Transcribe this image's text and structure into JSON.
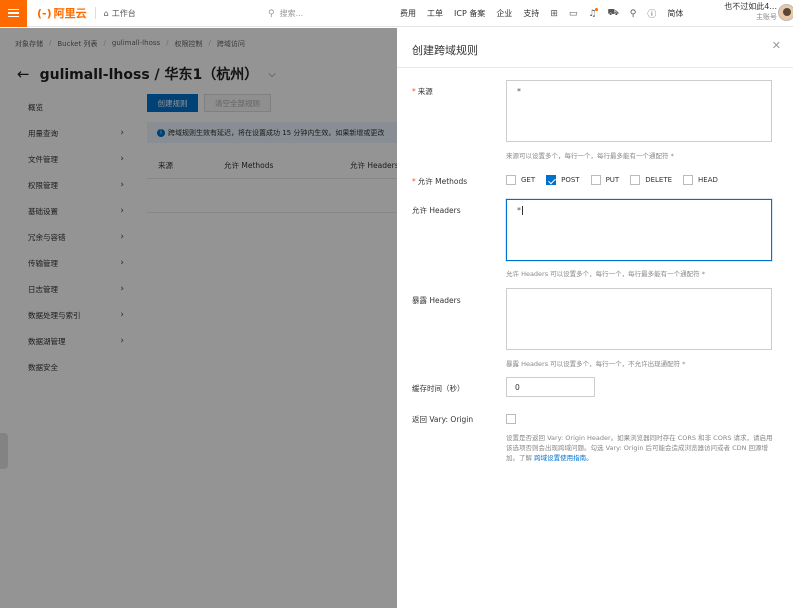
{
  "topbar": {
    "logo_text": "阿里云",
    "logo_mark": "(-)",
    "workbench": "工作台",
    "search_placeholder": "搜索...",
    "nav": [
      "费用",
      "工单",
      "ICP 备案",
      "企业",
      "支持"
    ],
    "lang": "简体",
    "user_name": "也不过如此4...",
    "user_role": "主账号"
  },
  "breadcrumb": [
    "对象存储",
    "Bucket 列表",
    "gulimall-lhoss",
    "权限控制",
    "跨域访问"
  ],
  "bucket": {
    "name": "gulimall-lhoss / 华东1（杭州）"
  },
  "sidenav": [
    {
      "label": "概览",
      "arrow": false
    },
    {
      "label": "用量查询",
      "arrow": true
    },
    {
      "label": "文件管理",
      "arrow": true
    },
    {
      "label": "权限管理",
      "arrow": true
    },
    {
      "label": "基础设置",
      "arrow": true
    },
    {
      "label": "冗余与容错",
      "arrow": true
    },
    {
      "label": "传输管理",
      "arrow": true
    },
    {
      "label": "日志管理",
      "arrow": true
    },
    {
      "label": "数据处理与索引",
      "arrow": true
    },
    {
      "label": "数据湖管理",
      "arrow": true
    },
    {
      "label": "数据安全",
      "arrow": false
    }
  ],
  "content": {
    "create_button": "创建规则",
    "clear_button": "清空全部规则",
    "notice": "跨域规则生效有延迟，将在设置成功 15 分钟内生效。如果新增或更改",
    "columns": [
      "来源",
      "允许 Methods",
      "允许 Headers"
    ]
  },
  "drawer": {
    "title": "创建跨域规则",
    "source_label": "来源",
    "source_value": "*",
    "source_help": "来源可以设置多个，每行一个，每行最多能有一个通配符 *",
    "methods_label": "允许 Methods",
    "methods": [
      {
        "name": "GET",
        "checked": false
      },
      {
        "name": "POST",
        "checked": true
      },
      {
        "name": "PUT",
        "checked": false
      },
      {
        "name": "DELETE",
        "checked": false
      },
      {
        "name": "HEAD",
        "checked": false
      }
    ],
    "headers_label": "允许 Headers",
    "headers_value": "*",
    "headers_help": "允许 Headers 可以设置多个，每行一个，每行最多能有一个通配符 *",
    "expose_label": "暴露 Headers",
    "expose_value": "",
    "expose_help": "暴露 Headers 可以设置多个，每行一个，不允许出现通配符 *",
    "cache_label": "缓存时间（秒）",
    "cache_value": "0",
    "vary_label": "返回 Vary: Origin",
    "vary_checked": false,
    "vary_help": "设置是否返回 Vary: Origin Header。如果浏览器同时存在 CORS 和非 CORS 请求，请启用该选项否则会出现跨域问题。勾选 Vary: Origin 后可能会造成浏览器访问或者 CDN 回源增加。了解",
    "vary_link": "跨域设置使用指南。"
  }
}
